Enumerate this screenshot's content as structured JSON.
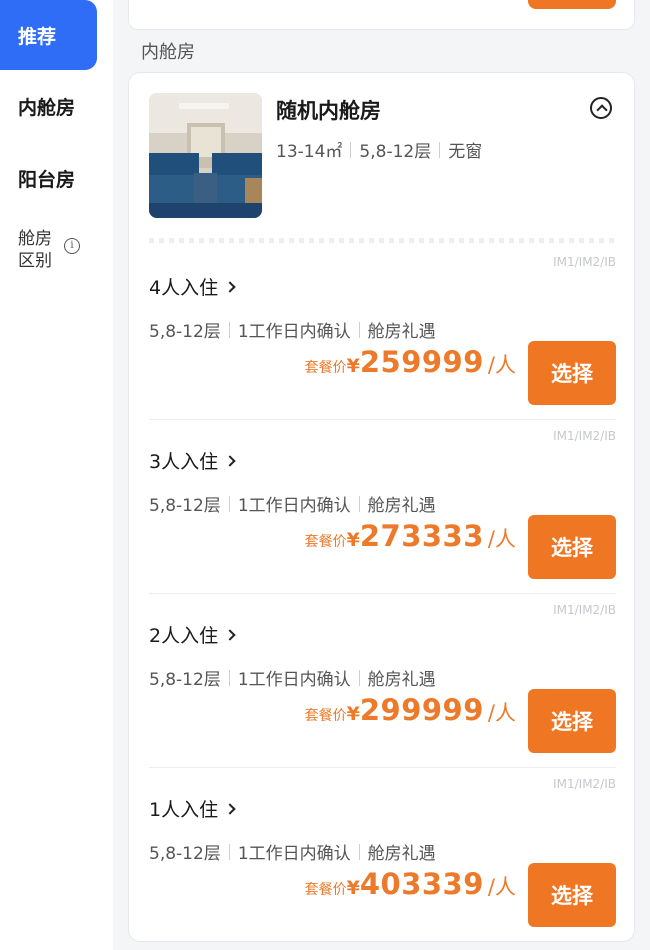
{
  "sidebar": {
    "items": [
      {
        "label": "推荐",
        "active": true
      },
      {
        "label": "内舱房",
        "active": false
      },
      {
        "label": "阳台房",
        "active": false
      }
    ],
    "diff_label": "舱房区别",
    "diff_icon": "info-icon"
  },
  "section_title": "内舱房",
  "room": {
    "name": "随机内舱房",
    "area": "13-14㎡",
    "floors": "5,8-12层",
    "window": "无窗",
    "collapse_icon": "chevron-up-circle-icon"
  },
  "options": [
    {
      "code": "IM1/IM2/IB",
      "occupancy": "4人入住",
      "floors": "5,8-12层",
      "confirm": "1工作日内确认",
      "perk": "舱房礼遇",
      "price_prefix": "套餐价",
      "currency": "¥",
      "price": "259999",
      "unit": "/人",
      "button": "选择"
    },
    {
      "code": "IM1/IM2/IB",
      "occupancy": "3人入住",
      "floors": "5,8-12层",
      "confirm": "1工作日内确认",
      "perk": "舱房礼遇",
      "price_prefix": "套餐价",
      "currency": "¥",
      "price": "273333",
      "unit": "/人",
      "button": "选择"
    },
    {
      "code": "IM1/IM2/IB",
      "occupancy": "2人入住",
      "floors": "5,8-12层",
      "confirm": "1工作日内确认",
      "perk": "舱房礼遇",
      "price_prefix": "套餐价",
      "currency": "¥",
      "price": "299999",
      "unit": "/人",
      "button": "选择"
    },
    {
      "code": "IM1/IM2/IB",
      "occupancy": "1人入住",
      "floors": "5,8-12层",
      "confirm": "1工作日内确认",
      "perk": "舱房礼遇",
      "price_prefix": "套餐价",
      "currency": "¥",
      "price": "403339",
      "unit": "/人",
      "button": "选择"
    }
  ],
  "colors": {
    "accent_blue": "#2f6df6",
    "accent_orange": "#ef7622",
    "price_orange": "#ec7a2a"
  }
}
